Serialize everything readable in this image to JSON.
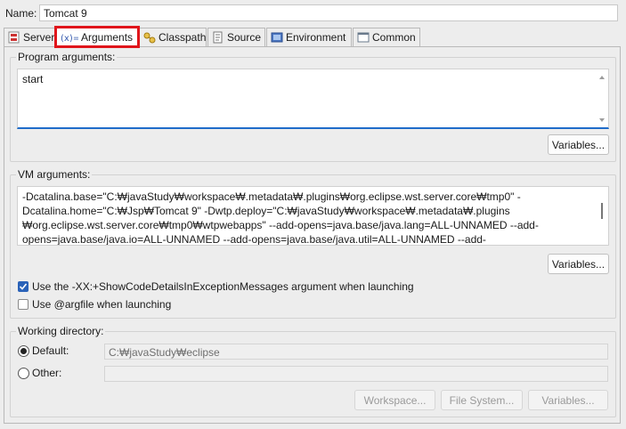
{
  "name": {
    "label": "Name:",
    "value": "Tomcat 9"
  },
  "tabs": [
    {
      "label": "Server",
      "icon": "server-icon"
    },
    {
      "label": "Arguments",
      "icon": "arguments-icon",
      "active": true
    },
    {
      "label": "Classpath",
      "icon": "classpath-icon"
    },
    {
      "label": "Source",
      "icon": "source-icon"
    },
    {
      "label": "Environment",
      "icon": "environment-icon"
    },
    {
      "label": "Common",
      "icon": "common-icon"
    }
  ],
  "program_args": {
    "title": "Program arguments:",
    "value": "start",
    "variables_label": "Variables..."
  },
  "vm_args": {
    "title": "VM arguments:",
    "lines": [
      "-Dcatalina.base=\"C:₩javaStudy₩workspace₩.metadata₩.plugins₩org.eclipse.wst.server.core₩tmp0\" -",
      "Dcatalina.home=\"C:₩Jsp₩Tomcat 9\" -Dwtp.deploy=\"C:₩javaStudy₩workspace₩.metadata₩.plugins",
      "₩org.eclipse.wst.server.core₩tmp0₩wtpwebapps\" --add-opens=java.base/java.lang=ALL-UNNAMED --add-",
      "opens=java.base/java.io=ALL-UNNAMED --add-opens=java.base/java.util=ALL-UNNAMED --add-"
    ],
    "variables_label": "Variables..."
  },
  "options": {
    "show_code_details": {
      "label": "Use the -XX:+ShowCodeDetailsInExceptionMessages argument when launching",
      "checked": true
    },
    "argfile": {
      "label": "Use @argfile when launching",
      "checked": false
    }
  },
  "working_dir": {
    "title": "Working directory:",
    "default_label": "Default:",
    "default_value": "C:₩javaStudy₩eclipse",
    "other_label": "Other:",
    "other_value": "",
    "workspace_label": "Workspace...",
    "filesystem_label": "File System...",
    "variables_label": "Variables..."
  },
  "colors": {
    "accent": "#2a62b8",
    "focus": "#1f6cc9",
    "highlight": "#e0151b"
  }
}
